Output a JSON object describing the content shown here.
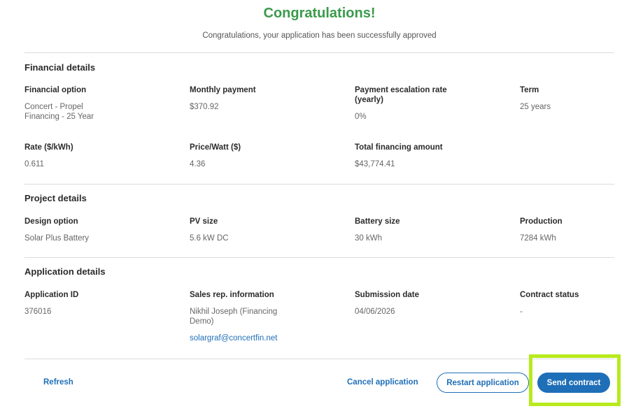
{
  "header": {
    "title": "Congratulations!",
    "subtitle": "Congratulations, your application has been successfully approved"
  },
  "financial": {
    "title": "Financial details",
    "fields": [
      {
        "label": "Financial option",
        "value": "Concert - Propel\nFinancing - 25 Year"
      },
      {
        "label": "Monthly payment",
        "value": "$370.92"
      },
      {
        "label": "Payment escalation rate\n(yearly)",
        "value": "0%"
      },
      {
        "label": "Term",
        "value": "25 years"
      },
      {
        "label": "Rate ($/kWh)",
        "value": "0.611"
      },
      {
        "label": "Price/Watt ($)",
        "value": "4.36"
      },
      {
        "label": "Total financing amount",
        "value": "$43,774.41"
      }
    ]
  },
  "project": {
    "title": "Project details",
    "fields": [
      {
        "label": "Design option",
        "value": "Solar Plus Battery"
      },
      {
        "label": "PV size",
        "value": "5.6 kW DC"
      },
      {
        "label": "Battery size",
        "value": "30 kWh"
      },
      {
        "label": "Production",
        "value": "7284 kWh"
      }
    ]
  },
  "application": {
    "title": "Application details",
    "fields": [
      {
        "label": "Application ID",
        "value": "376016"
      },
      {
        "label": "Sales rep. information",
        "value": "Nikhil Joseph (Financing\nDemo)",
        "email": "solargraf@concertfin.net"
      },
      {
        "label": "Submission date",
        "value": "04/06/2026"
      },
      {
        "label": "Contract status",
        "value": "-"
      }
    ]
  },
  "actions": {
    "refresh": "Refresh",
    "cancel": "Cancel application",
    "restart": "Restart application",
    "send": "Send contract"
  },
  "colors": {
    "success_green": "#3b9a4c",
    "primary_blue": "#1f6fb8",
    "highlight": "#b7ea1c"
  }
}
